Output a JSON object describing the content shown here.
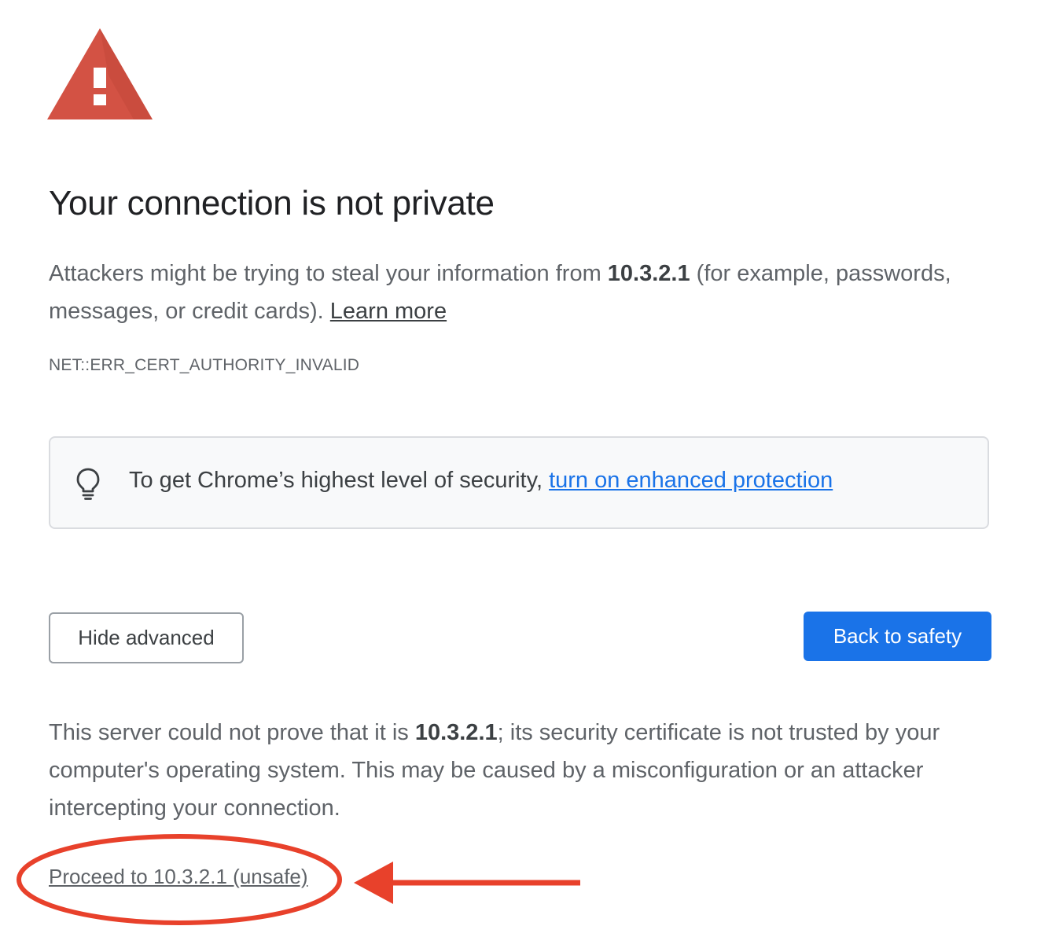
{
  "page": {
    "headline": "Your connection is not private",
    "intro": {
      "text_before": "Attackers might be trying to steal your information from ",
      "host": "10.3.2.1",
      "text_after": " (for example, passwords, messages, or credit cards). ",
      "learn_more": "Learn more"
    },
    "error_code": "NET::ERR_CERT_AUTHORITY_INVALID",
    "enhanced_protection": {
      "text": "To get Chrome’s highest level of security, ",
      "link": "turn on enhanced protection"
    },
    "buttons": {
      "hide_advanced": "Hide advanced",
      "back_to_safety": "Back to safety"
    },
    "details": {
      "text_before": "This server could not prove that it is ",
      "host": "10.3.2.1",
      "text_after": "; its security certificate is not trusted by your computer's operating system. This may be caused by a misconfiguration or an attacker intercepting your connection."
    },
    "proceed_link": "Proceed to 10.3.2.1 (unsafe)"
  },
  "icons": {
    "warning": "warning-triangle-icon",
    "lightbulb": "lightbulb-icon"
  },
  "colors": {
    "warning_red": "#d35244",
    "primary_blue": "#1a73e8",
    "annotation_red": "#e8412b"
  }
}
